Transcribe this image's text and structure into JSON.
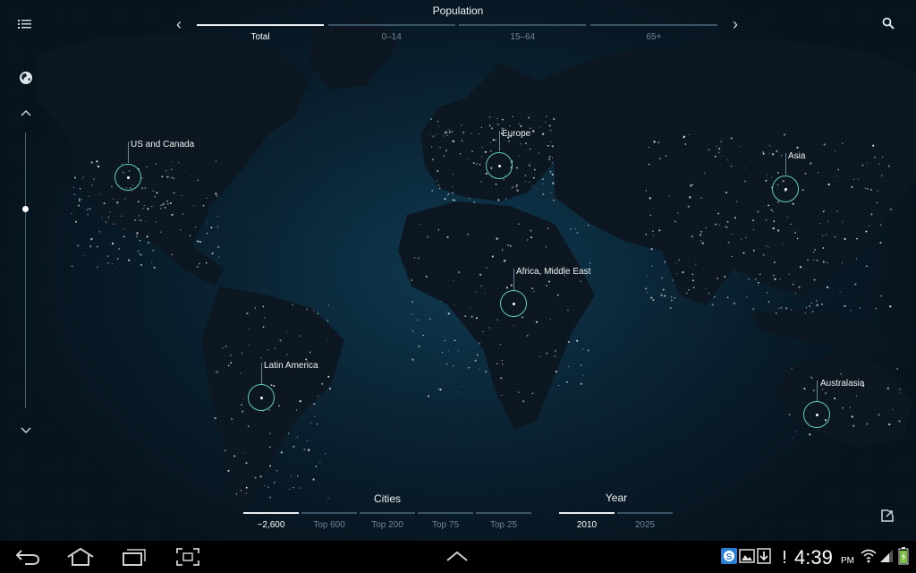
{
  "header": {
    "title": "Population",
    "tabs": [
      {
        "label": "Total",
        "active": true
      },
      {
        "label": "0–14",
        "active": false
      },
      {
        "label": "15–64",
        "active": false
      },
      {
        "label": "65+",
        "active": false
      }
    ]
  },
  "regions": [
    {
      "label": "US and Canada"
    },
    {
      "label": "Europe"
    },
    {
      "label": "Asia"
    },
    {
      "label": "Africa, Middle East"
    },
    {
      "label": "Latin America"
    },
    {
      "label": "Australasia"
    }
  ],
  "cities": {
    "title": "Cities",
    "options": [
      {
        "label": "~2,600",
        "active": true
      },
      {
        "label": "Top 600",
        "active": false
      },
      {
        "label": "Top 200",
        "active": false
      },
      {
        "label": "Top 75",
        "active": false
      },
      {
        "label": "Top 25",
        "active": false
      }
    ]
  },
  "year": {
    "title": "Year",
    "options": [
      {
        "label": "2010",
        "active": true
      },
      {
        "label": "2025",
        "active": false
      }
    ]
  },
  "status_bar": {
    "time": "4:39",
    "ampm": "PM"
  },
  "colors": {
    "ring": "#5fcfb8",
    "active": "#e8eef1",
    "inactive": "#3b5566"
  }
}
